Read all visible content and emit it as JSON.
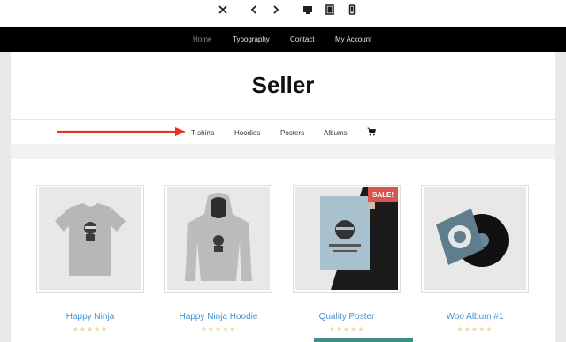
{
  "toolbar": {
    "icons": [
      "close-icon",
      "back-icon",
      "forward-icon",
      "desktop-icon",
      "tablet-icon",
      "mobile-icon"
    ]
  },
  "topnav": {
    "items": [
      "Home",
      "Typography",
      "Contact",
      "My Account"
    ],
    "active_color": "#8a8a8a"
  },
  "site": {
    "title": "Seller"
  },
  "subnav": {
    "items": [
      "T-shirts",
      "Hoodies",
      "Posters",
      "Albums"
    ]
  },
  "annotation": {
    "arrow_color": "#e53222"
  },
  "products": [
    {
      "name": "Happy Ninja",
      "stars": "★★★★★",
      "sale": ""
    },
    {
      "name": "Happy Ninja Hoodie",
      "stars": "★★★★★",
      "sale": ""
    },
    {
      "name": "Quality Poster",
      "stars": "★★★★★",
      "sale": "SALE!"
    },
    {
      "name": "Woo Album #1",
      "stars": "★★★★★",
      "sale": ""
    }
  ],
  "colors": {
    "sale_badge": "#d9534f",
    "product_link": "#4a90c8",
    "topnav_bg": "#000000"
  }
}
